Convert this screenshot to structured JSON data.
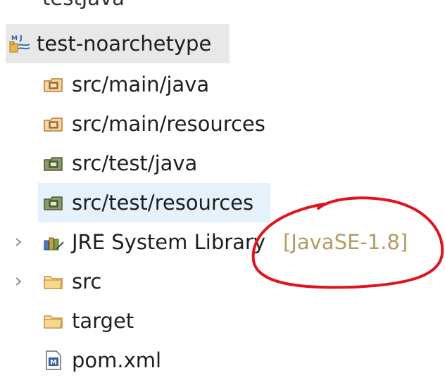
{
  "tree": {
    "partial_top_label": "testJava",
    "project": {
      "label": "test-noarchetype"
    },
    "items": [
      {
        "label": "src/main/java",
        "icon": "source-folder-icon"
      },
      {
        "label": "src/main/resources",
        "icon": "source-folder-icon"
      },
      {
        "label": "src/test/java",
        "icon": "test-source-folder-icon"
      },
      {
        "label": "src/test/resources",
        "icon": "test-source-folder-icon"
      },
      {
        "label": "JRE System Library",
        "decoration": "[JavaSE-1.8]",
        "icon": "library-icon"
      },
      {
        "label": "src",
        "icon": "folder-icon"
      },
      {
        "label": "target",
        "icon": "folder-icon"
      },
      {
        "label": "pom.xml",
        "icon": "maven-file-icon"
      }
    ]
  },
  "colors": {
    "project_row_bg": "#e8e8e8",
    "hover_row_bg": "#e5f1fb",
    "decoration_text": "#b39b68",
    "annotation_circle": "#e0141e"
  }
}
